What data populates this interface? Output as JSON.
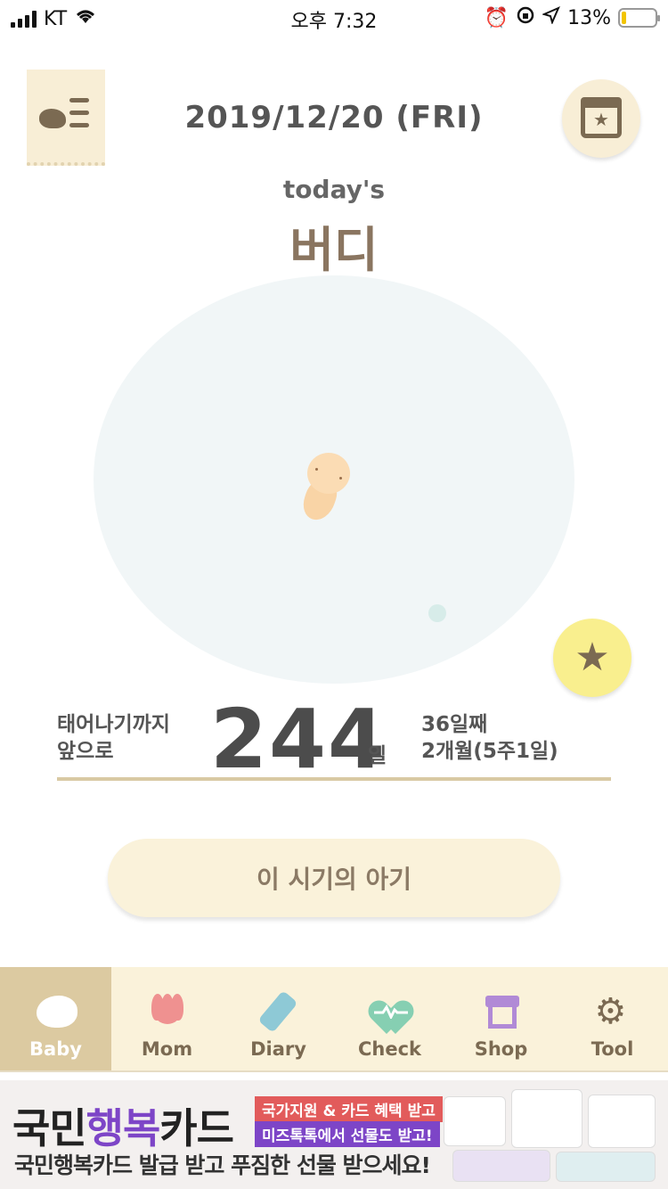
{
  "status_bar": {
    "carrier": "KT",
    "time": "오후 7:32",
    "battery": "13%",
    "battery_level": 0.13
  },
  "header": {
    "date": "2019/12/20 (FRI)",
    "menu_icon": "menu-bird-icon",
    "calendar_icon": "calendar-star-icon"
  },
  "main": {
    "today_label": "today's",
    "baby_name": "버디",
    "countdown_prefix_line1": "태어나기까지",
    "countdown_prefix_line2": "앞으로",
    "days_remaining": "244",
    "days_unit": "일",
    "day_count": "36일째",
    "age": "2개월(5주1일)",
    "info_button_label": "이 시기의 아기"
  },
  "tabs": [
    {
      "label": "Baby",
      "icon": "bird-icon",
      "active": true
    },
    {
      "label": "Mom",
      "icon": "tulip-icon",
      "active": false
    },
    {
      "label": "Diary",
      "icon": "pencil-icon",
      "active": false
    },
    {
      "label": "Check",
      "icon": "heart-pulse-icon",
      "active": false
    },
    {
      "label": "Shop",
      "icon": "store-icon",
      "active": false
    },
    {
      "label": "Tool",
      "icon": "gear-icon",
      "active": false
    }
  ],
  "ad": {
    "title_part1": "국민",
    "title_accent": "행복",
    "title_part2": "카드",
    "tag1": "국가지원 & 카드 혜택 받고",
    "tag2": "미즈톡톡에서 선물도 받고!",
    "subtitle": "국민행복카드 발급 받고 푸짐한 선물 받으세요!"
  },
  "colors": {
    "brand_beige": "#faf2da",
    "tab_active": "#dccaa1",
    "text_brown": "#7b6a52",
    "star_yellow": "#f9ef8e"
  }
}
